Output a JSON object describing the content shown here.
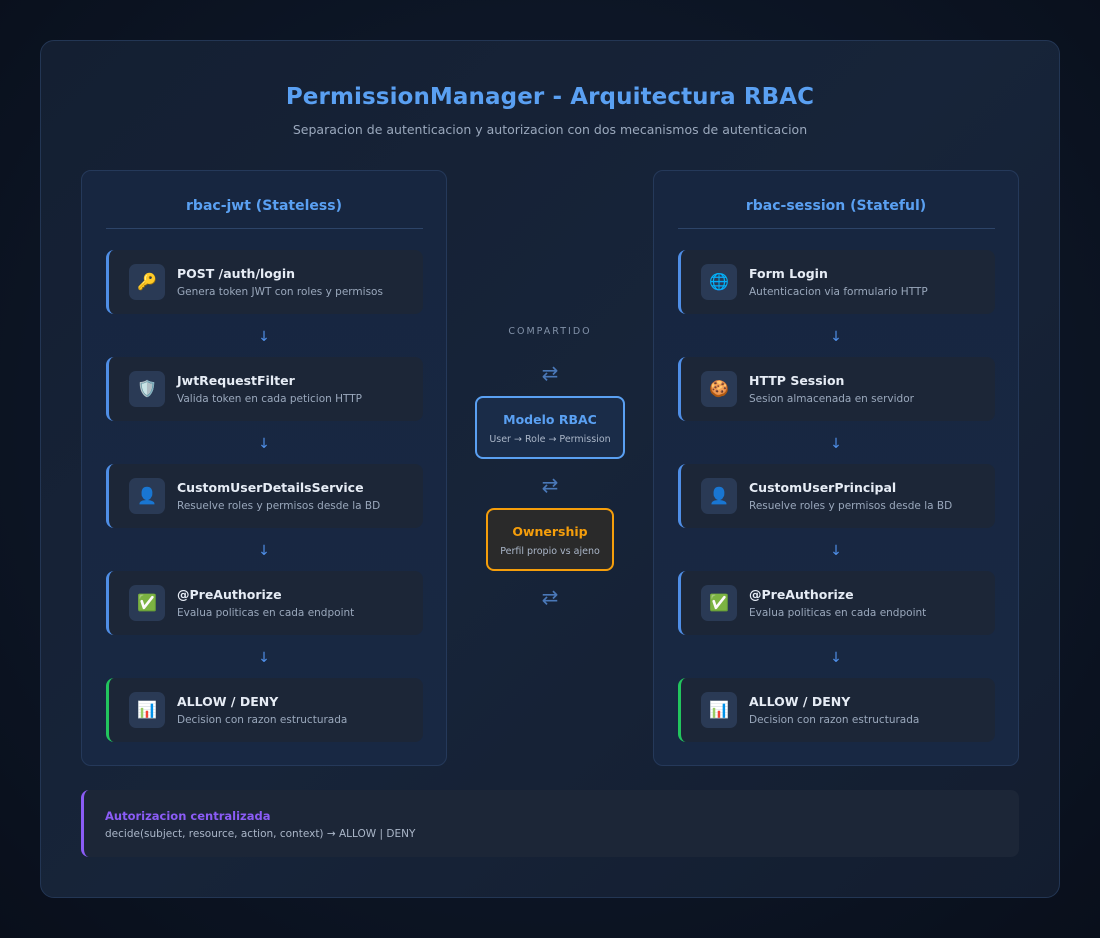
{
  "title": "PermissionManager - Arquitectura RBAC",
  "subtitle": "Separacion de autenticacion y autorizacion con dos mecanismos de autenticacion",
  "left": {
    "title": "rbac-jwt (Stateless)",
    "steps": [
      {
        "icon": "🔑",
        "icon_name": "key-icon",
        "title": "POST /auth/login",
        "desc": "Genera token JWT con roles y permisos"
      },
      {
        "icon": "🛡️",
        "icon_name": "shield-icon",
        "title": "JwtRequestFilter",
        "desc": "Valida token en cada peticion HTTP"
      },
      {
        "icon": "👤",
        "icon_name": "user-icon",
        "title": "CustomUserDetailsService",
        "desc": "Resuelve roles y permisos desde la BD"
      },
      {
        "icon": "✅",
        "icon_name": "check-icon",
        "title": "@PreAuthorize",
        "desc": "Evalua politicas en cada endpoint"
      },
      {
        "icon": "📊",
        "icon_name": "chart-icon",
        "title": "ALLOW / DENY",
        "desc": "Decision con razon estructurada"
      }
    ]
  },
  "right": {
    "title": "rbac-session (Stateful)",
    "steps": [
      {
        "icon": "🌐",
        "icon_name": "globe-icon",
        "title": "Form Login",
        "desc": "Autenticacion via formulario HTTP"
      },
      {
        "icon": "🍪",
        "icon_name": "cookie-icon",
        "title": "HTTP Session",
        "desc": "Sesion almacenada en servidor"
      },
      {
        "icon": "👤",
        "icon_name": "user-icon",
        "title": "CustomUserPrincipal",
        "desc": "Resuelve roles y permisos desde la BD"
      },
      {
        "icon": "✅",
        "icon_name": "check-icon",
        "title": "@PreAuthorize",
        "desc": "Evalua politicas en cada endpoint"
      },
      {
        "icon": "📊",
        "icon_name": "chart-icon",
        "title": "ALLOW / DENY",
        "desc": "Decision con razon estructurada"
      }
    ]
  },
  "arrow_glyph": "↓",
  "swap_glyph": "⇄",
  "shared": {
    "label": "COMPARTIDO",
    "rbac_title": "Modelo RBAC",
    "rbac_sub": "User → Role → Permission",
    "ownership_title": "Ownership",
    "ownership_sub": "Perfil propio vs ajeno"
  },
  "bottom": {
    "title": "Autorizacion centralizada",
    "text": "decide(subject, resource, action, context) → ALLOW | DENY"
  },
  "colors": {
    "accent_blue": "#5aa0f2",
    "allow_green": "#22c55e",
    "ownership_orange": "#f59e0b",
    "central_purple": "#8b5cf6"
  }
}
